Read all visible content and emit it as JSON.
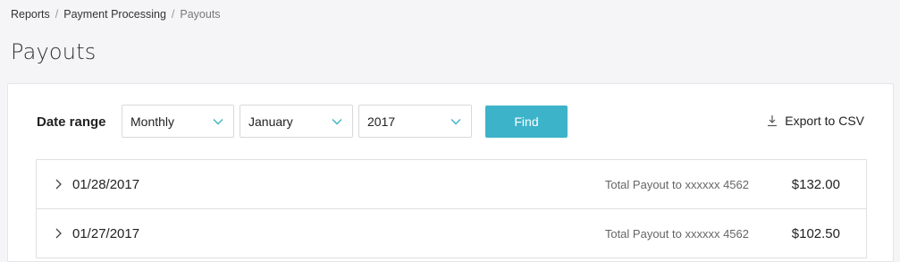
{
  "breadcrumb": {
    "items": [
      "Reports",
      "Payment Processing"
    ],
    "current": "Payouts",
    "separator": "/"
  },
  "page": {
    "title": "Payouts"
  },
  "filters": {
    "label": "Date range",
    "period": "Monthly",
    "month": "January",
    "year": "2017",
    "find_label": "Find",
    "export_label": "Export to CSV"
  },
  "payouts": [
    {
      "date": "01/28/2017",
      "description": "Total Payout to xxxxxx 4562",
      "amount": "$132.00"
    },
    {
      "date": "01/27/2017",
      "description": "Total Payout to xxxxxx 4562",
      "amount": "$102.50"
    }
  ],
  "colors": {
    "accent": "#3db3c9",
    "chevron": "#3db3c9"
  },
  "icons": {
    "dropdown": "chevron-down-icon",
    "export": "download-icon",
    "row_expand": "chevron-right-icon"
  }
}
